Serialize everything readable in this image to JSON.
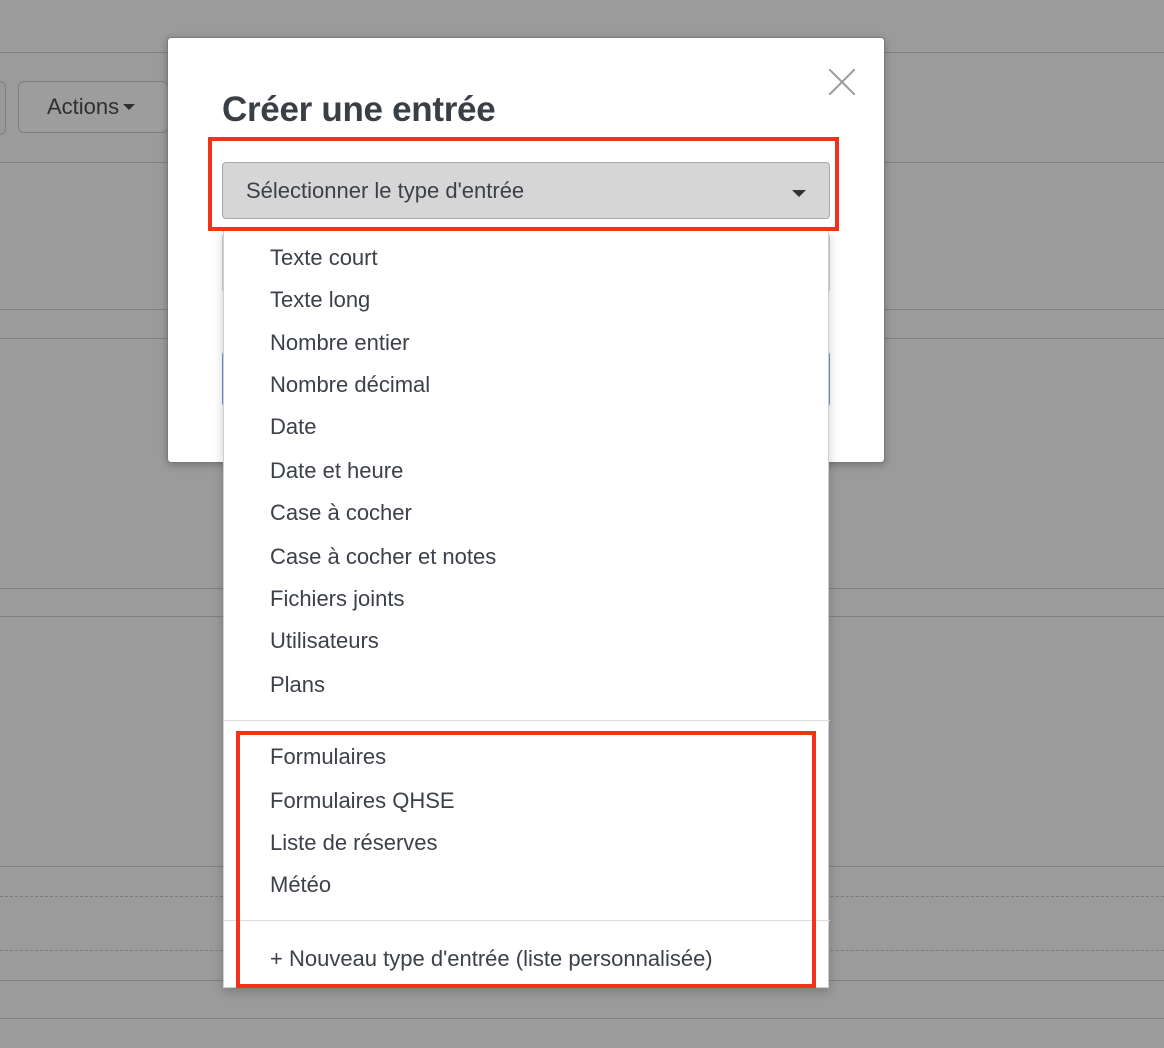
{
  "background": {
    "actions_label": "Actions"
  },
  "modal": {
    "title": "Créer une entrée"
  },
  "select": {
    "placeholder": "Sélectionner le type d'entrée"
  },
  "dropdown": {
    "basic_types": [
      "Texte court",
      "Texte long",
      "Nombre entier",
      "Nombre décimal",
      "Date",
      "Date et heure",
      "Case à cocher",
      "Case à cocher et notes",
      "Fichiers joints",
      "Utilisateurs",
      "Plans"
    ],
    "module_types": [
      "Formulaires",
      "Formulaires QHSE",
      "Liste de réserves",
      "Météo"
    ],
    "new_type_label": "+ Nouveau type d'entrée (liste personnalisée)"
  },
  "colors": {
    "highlight": "#f4311a",
    "overlay": "#9b9b9b",
    "select_background": "#d6d6d6"
  }
}
